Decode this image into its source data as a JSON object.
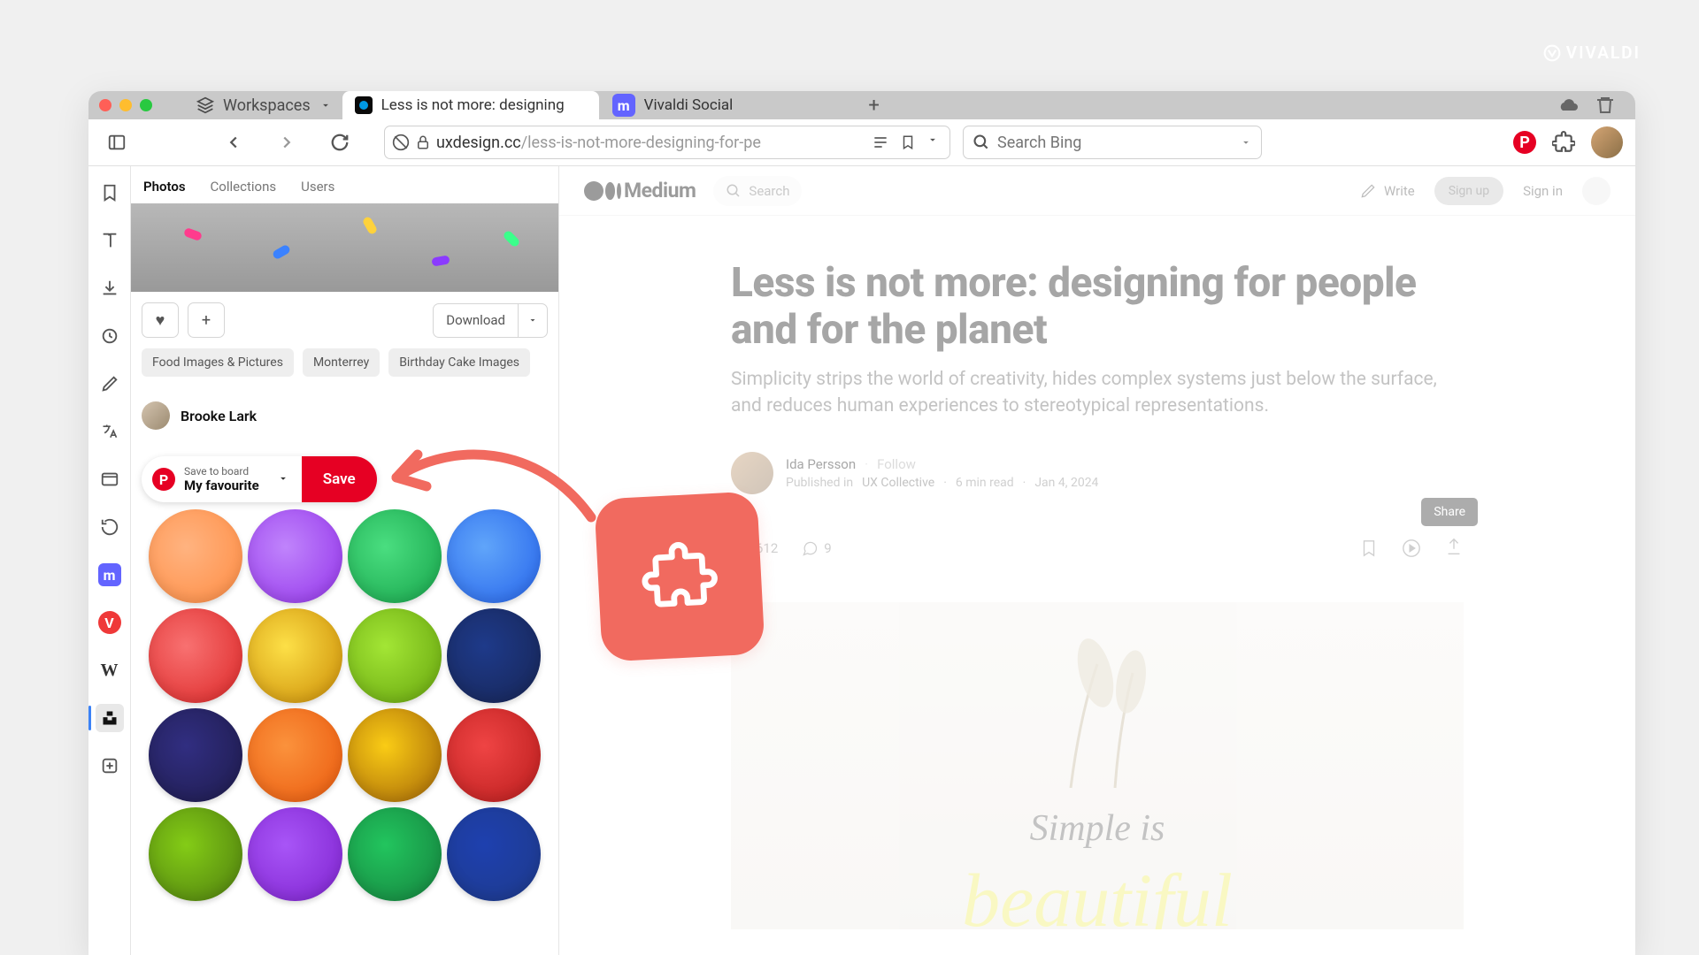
{
  "watermark": "VIVALDI",
  "workspaces_label": "Workspaces",
  "tabs": [
    {
      "title": "Less is not more: designing",
      "active": true,
      "favicon_bg": "#0a0a0a"
    },
    {
      "title": "Vivaldi Social",
      "active": false,
      "favicon_bg": "#6364ff"
    }
  ],
  "url": {
    "host": "uxdesign.cc",
    "path": "/less-is-not-more-designing-for-pe"
  },
  "search_placeholder": "Search Bing",
  "photo_panel": {
    "tabs": [
      "Photos",
      "Collections",
      "Users"
    ],
    "active_tab": "Photos",
    "download_label": "Download",
    "chips": [
      "Food Images & Pictures",
      "Monterrey",
      "Birthday Cake Images"
    ],
    "photographer": "Brooke Lark",
    "pin": {
      "subtitle": "Save to board",
      "board": "My favourite",
      "save_label": "Save"
    }
  },
  "medium": {
    "logo": "Medium",
    "search_placeholder": "Search",
    "write": "Write",
    "signup": "Sign up",
    "signin": "Sign in"
  },
  "article": {
    "title": "Less is not more: designing for people and for the planet",
    "subtitle": "Simplicity strips the world of creativity, hides complex systems just below the surface, and reduces human experiences to stereotypical representations.",
    "author": "Ida Persson",
    "follow": "Follow",
    "published_in_prefix": "Published in",
    "publication": "UX Collective",
    "read_time": "6 min read",
    "date": "Jan 4, 2024",
    "claps": "612",
    "comments": "9",
    "share_tooltip": "Share",
    "hero_line1": "Simple is",
    "hero_line2": "beautiful"
  }
}
